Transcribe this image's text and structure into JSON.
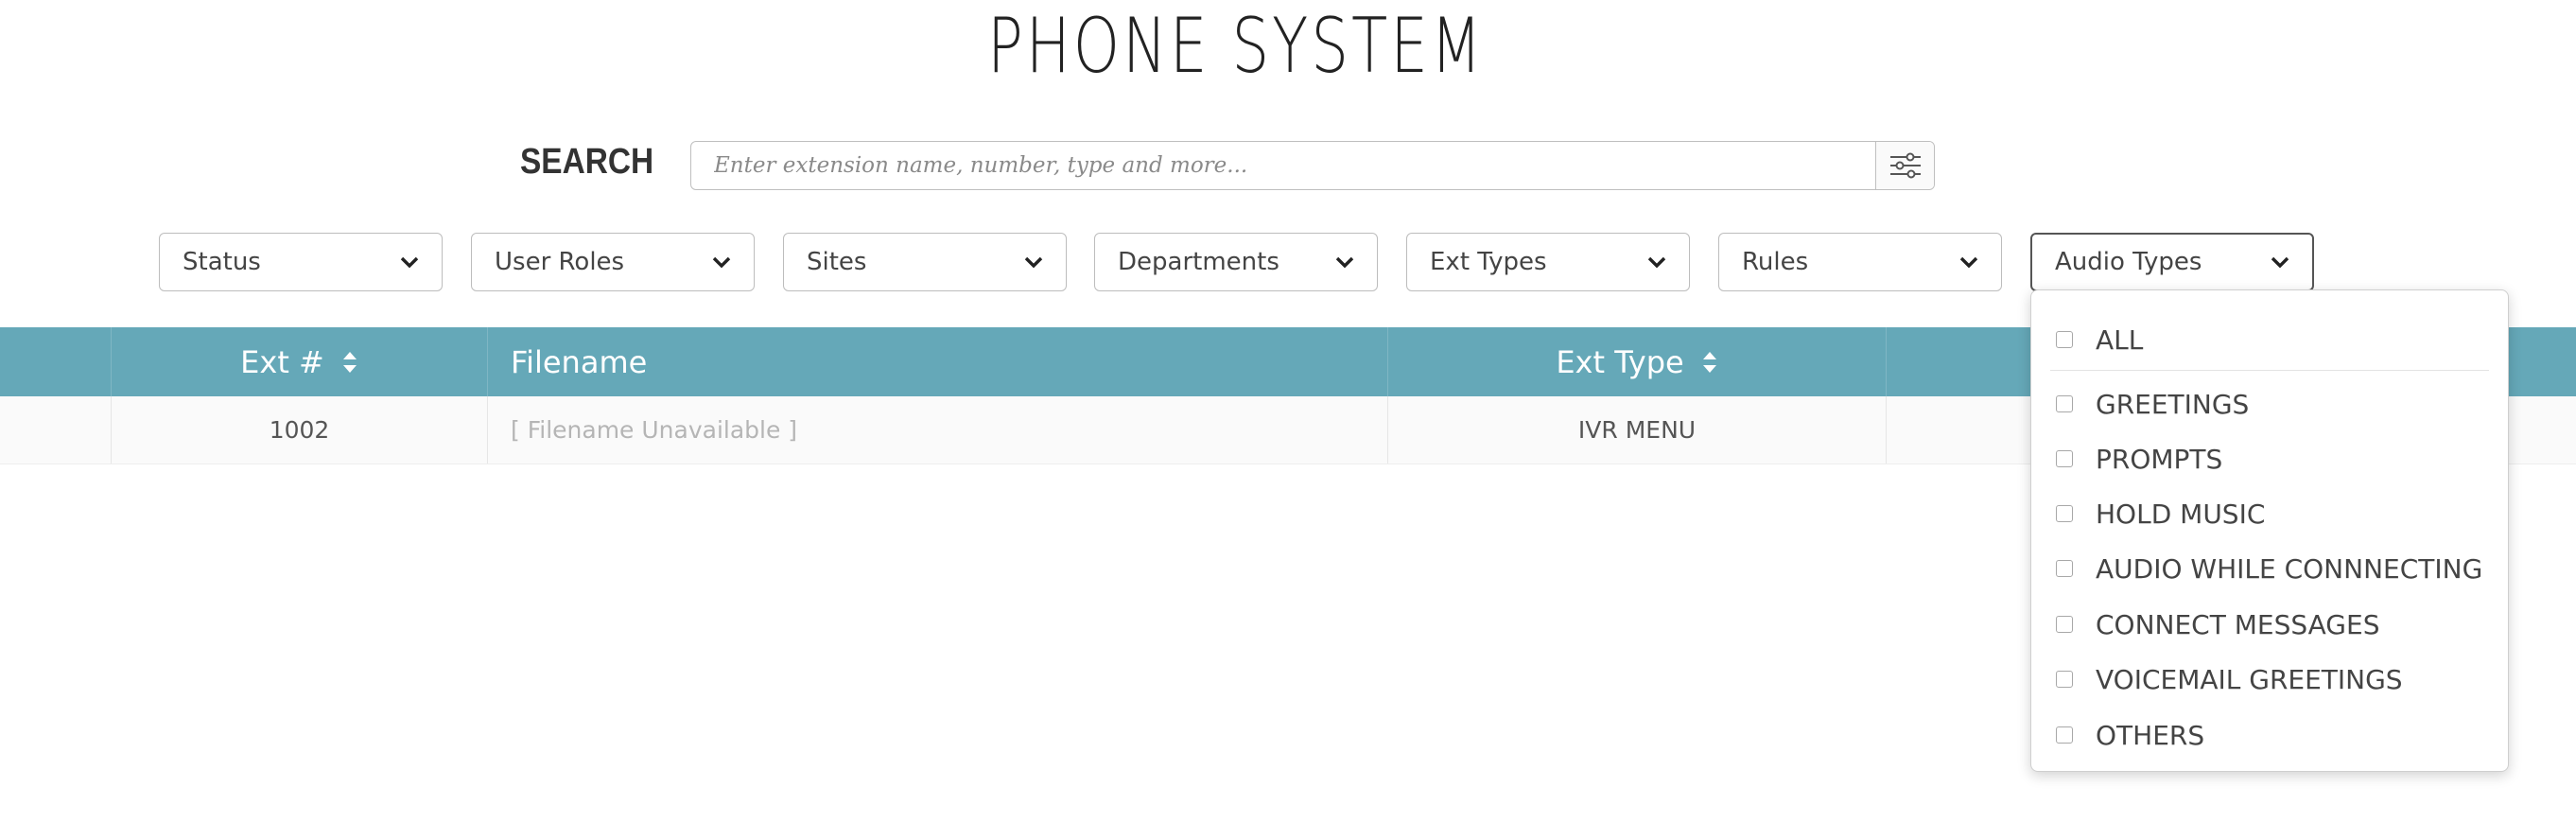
{
  "page_title": "PHONE SYSTEM",
  "search": {
    "label": "SEARCH",
    "placeholder": "Enter extension name, number, type and more...",
    "filter_icon": "sliders-icon"
  },
  "filters": [
    {
      "label": "Status"
    },
    {
      "label": "User Roles"
    },
    {
      "label": "Sites"
    },
    {
      "label": "Departments"
    },
    {
      "label": "Ext Types"
    },
    {
      "label": "Rules"
    },
    {
      "label": "Audio Types",
      "open": true
    }
  ],
  "table": {
    "header_color": "#65a8b8",
    "columns": [
      "Ext #",
      "Filename",
      "Ext Type"
    ],
    "rows": [
      {
        "ext": "1002",
        "filename": "[ Filename Unavailable ]",
        "ext_type": "IVR MENU"
      }
    ]
  },
  "audio_types_menu": {
    "options": [
      "ALL",
      "GREETINGS",
      "PROMPTS",
      "HOLD MUSIC",
      "AUDIO WHILE CONNNECTING",
      "CONNECT MESSAGES",
      "VOICEMAIL GREETINGS",
      "OTHERS"
    ]
  }
}
